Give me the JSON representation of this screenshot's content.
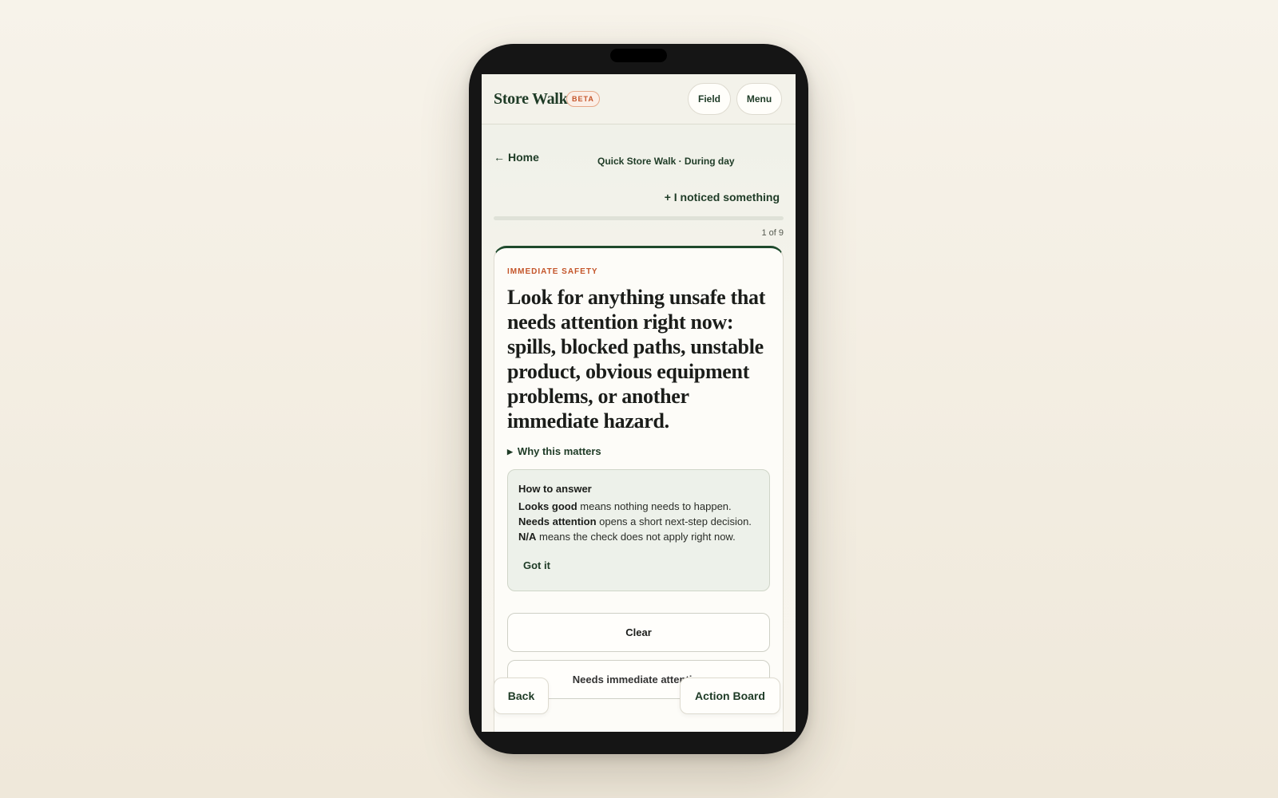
{
  "app": {
    "title": "Store Walk",
    "badge": "BETA"
  },
  "header": {
    "field_label": "Field",
    "menu_label": "Menu"
  },
  "nav": {
    "home_arrow": "←",
    "home_label": "Home",
    "walk_title": "Quick Store Walk · During day",
    "noticed_label": "+ I noticed something"
  },
  "progress": {
    "current": 1,
    "total": 9,
    "fraction": 0,
    "label": "1 of 9"
  },
  "card": {
    "category": "IMMEDIATE SAFETY",
    "question": "Look for anything unsafe that needs attention right now: spills, blocked paths, unstable product, obvious equipment problems, or another immediate hazard.",
    "why_label": "Why this matters",
    "howto": {
      "title": "How to answer",
      "lines": [
        {
          "term": "Looks good",
          "desc": " means nothing needs to happen."
        },
        {
          "term": "Needs attention",
          "desc": " opens a short next-step decision."
        },
        {
          "term": "N/A",
          "desc": " means the check does not apply right now."
        }
      ],
      "got_it": "Got it"
    },
    "answers": {
      "clear": "Clear",
      "needs_attention": "Needs immediate attention"
    }
  },
  "footer": {
    "back_label": "Back",
    "board_label": "Action Board"
  },
  "colors": {
    "brand_green": "#1e3b26",
    "accent_orange": "#c4552a"
  }
}
